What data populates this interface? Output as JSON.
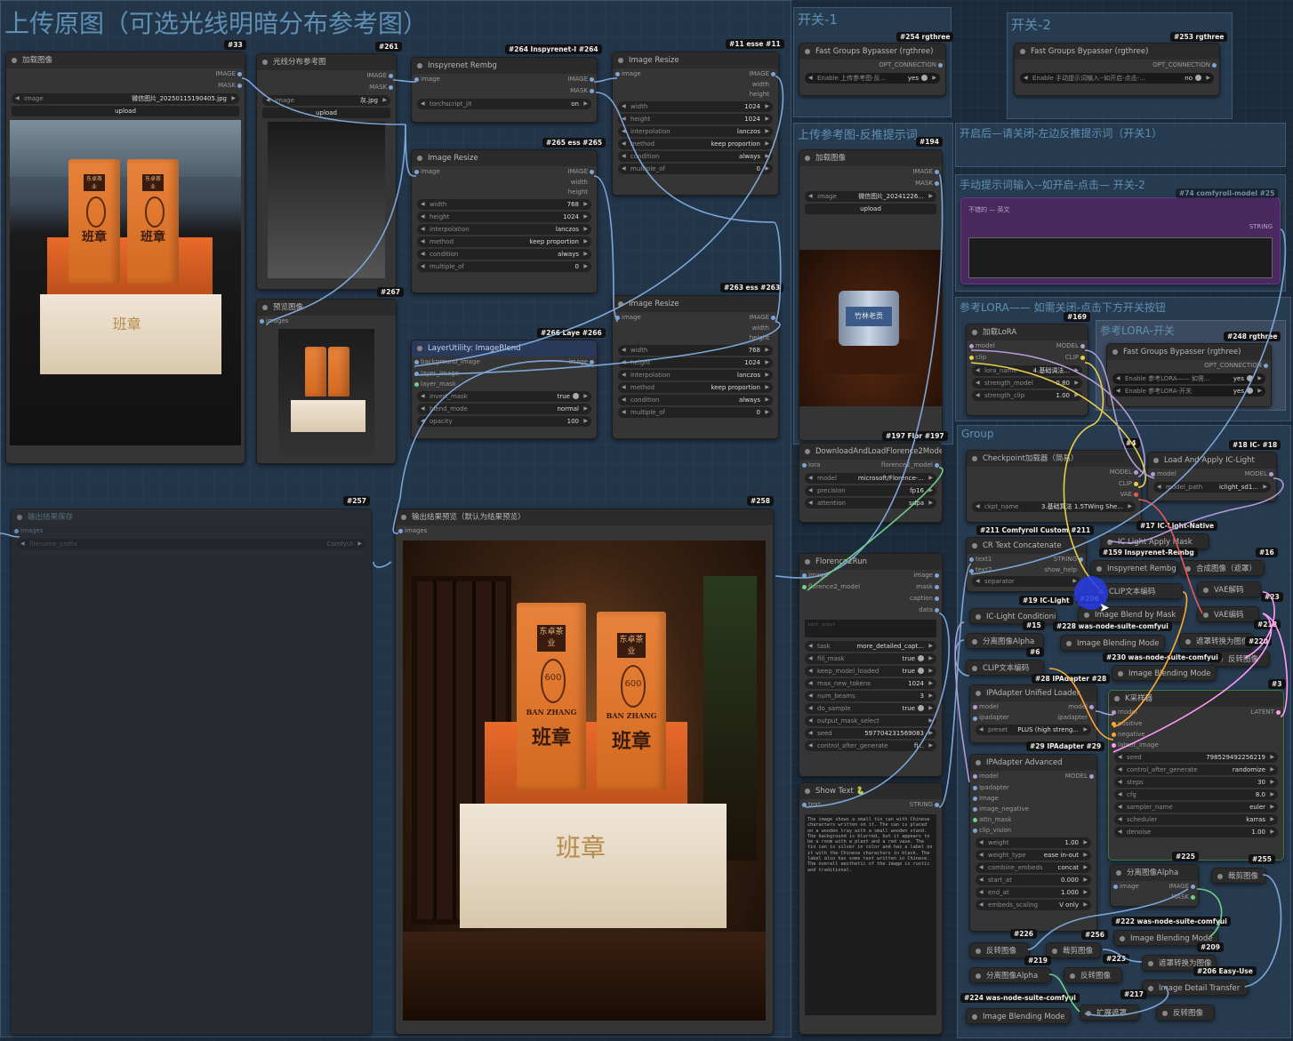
{
  "groups": {
    "main": "上传原图（可选光线明暗分布参考图）",
    "switch1": "开关-1",
    "switch2": "开关-2",
    "ref_upload": "上传参考图-反推提示词",
    "auto_prompt": "开启后—请关闭-左边反推提示词（开关1）",
    "manual_prompt": "手动提示词输入--如开启-点击— 开关-2",
    "lora_group": "参考LORA—— 如需关闭-点击下方开关按钮",
    "lora_switch": "参考LORA-开关",
    "group": "Group"
  },
  "nodes": {
    "load_image": {
      "title": "加载图像",
      "badge": "#33",
      "outputs": [
        "IMAGE",
        "MASK"
      ],
      "image_label": "image",
      "image_value": "微信图片_20250115190405.jpg",
      "upload": "upload"
    },
    "light_ref": {
      "title": "光线分布参考图",
      "badge": "#261",
      "outputs": [
        "IMAGE",
        "MASK"
      ],
      "image_label": "image",
      "image_value": "灰.jpg",
      "upload": "upload"
    },
    "preview": {
      "title": "预览图像",
      "badge": "#267",
      "input": "images"
    },
    "rembg": {
      "title": "Inspyrenet Rembg",
      "badge": "#264 Inspyrenet-I #264",
      "input": "image",
      "outputs": [
        "IMAGE",
        "MASK"
      ],
      "widget_label": "torchscript_jit",
      "widget_value": "on"
    },
    "resize_265": {
      "title": "Image Resize",
      "badge": "#265 ess #265",
      "input": "image",
      "outputs": [
        "IMAGE",
        "width",
        "height"
      ],
      "widgets": [
        {
          "label": "width",
          "value": "768"
        },
        {
          "label": "height",
          "value": "1024"
        },
        {
          "label": "interpolation",
          "value": "lanczos"
        },
        {
          "label": "method",
          "value": "keep proportion"
        },
        {
          "label": "condition",
          "value": "always"
        },
        {
          "label": "multiple_of",
          "value": "0"
        }
      ]
    },
    "resize_11": {
      "title": "Image Resize",
      "badge": "#11 esse #11",
      "input": "image",
      "outputs": [
        "IMAGE",
        "width",
        "height"
      ],
      "widgets": [
        {
          "label": "width",
          "value": "1024"
        },
        {
          "label": "height",
          "value": "1024"
        },
        {
          "label": "interpolation",
          "value": "lanczos"
        },
        {
          "label": "method",
          "value": "keep proportion"
        },
        {
          "label": "condition",
          "value": "always"
        },
        {
          "label": "multiple_of",
          "value": "0"
        }
      ]
    },
    "resize_263": {
      "title": "Image Resize",
      "badge": "#263 ess #263",
      "input": "image",
      "outputs": [
        "IMAGE",
        "width",
        "height"
      ],
      "widgets": [
        {
          "label": "width",
          "value": "768"
        },
        {
          "label": "height",
          "value": "1024"
        },
        {
          "label": "interpolation",
          "value": "lanczos"
        },
        {
          "label": "method",
          "value": "keep proportion"
        },
        {
          "label": "condition",
          "value": "always"
        },
        {
          "label": "multiple_of",
          "value": "0"
        }
      ]
    },
    "blend": {
      "title": "LayerUtility: ImageBlend",
      "badge": "#266 Laye #266",
      "inputs": [
        "background_image",
        "layer_image",
        "layer_mask"
      ],
      "output": "image",
      "widgets": [
        {
          "label": "invert_mask",
          "value": "true"
        },
        {
          "label": "blend_mode",
          "value": "normal"
        },
        {
          "label": "opacity",
          "value": "100"
        }
      ]
    },
    "save": {
      "title": "输出结果保存",
      "badge": "#257",
      "input": "images",
      "prefix_label": "filename_prefix",
      "prefix_value": "ComfyUI"
    },
    "result_preview": {
      "title": "输出结果预览（默认为结果预览）",
      "badge": "#258",
      "input": "images"
    },
    "fast1": {
      "title": "Fast Groups Bypasser (rgthree)",
      "badge": "#254 rgthree",
      "output": "OPT_CONNECTION",
      "toggle_label": "Enable 上传参考图-反...",
      "toggle_value": "yes"
    },
    "fast2": {
      "title": "Fast Groups Bypasser (rgthree)",
      "badge": "#253 rgthree",
      "output": "OPT_CONNECTION",
      "toggle_label": "Enable 手动提示词输入--如开启-点击-...",
      "toggle_value": "no"
    },
    "load_ref": {
      "title": "加载图像",
      "badge": "#194",
      "outputs": [
        "IMAGE",
        "MASK"
      ],
      "image_label": "image",
      "image_value": "微信图片_20241226...",
      "upload": "upload"
    },
    "florence_loader": {
      "title": "DownloadAndLoadFlorence2Model",
      "badge": "#197 Flor #197",
      "input": "lora",
      "output": "florence2_model",
      "widgets": [
        {
          "label": "model",
          "value": "microsoft/Florence-..."
        },
        {
          "label": "precision",
          "value": "fp16"
        },
        {
          "label": "attention",
          "value": "sdpa"
        }
      ]
    },
    "florence_run": {
      "title": "Florence2Run",
      "inputs": [
        "image",
        "florence2_model"
      ],
      "outputs": [
        "image",
        "mask",
        "caption",
        "data"
      ],
      "text_placeholder": "text_input",
      "widgets": [
        {
          "label": "task",
          "value": "more_detailed_capt..."
        },
        {
          "label": "fill_mask",
          "value": "true"
        },
        {
          "label": "keep_model_loaded",
          "value": "true"
        },
        {
          "label": "max_new_tokens",
          "value": "1024"
        },
        {
          "label": "num_beams",
          "value": "3"
        },
        {
          "label": "do_sample",
          "value": "true"
        },
        {
          "label": "output_mask_select",
          "value": ""
        },
        {
          "label": "seed",
          "value": "597704231569083"
        },
        {
          "label": "control_after_generate",
          "value": "fi..."
        }
      ]
    },
    "show_text": {
      "title": "Show Text 🐍",
      "input": "text",
      "output": "STRING",
      "content": "The image shows a small tin can with Chinese characters written on it. The can is placed on a wooden tray with a small wooden stand. The background is blurred, but it appears to be a room with a plant and a red vase. The tin can is silver in color and has a label on it with the Chinese characters in black. The label also has some text written in Chinese. The overall aesthetic of the image is rustic and traditional."
    },
    "manual_text": {
      "badge": "#74 comfyroll-model #25",
      "line1": "不错的 — 英文",
      "hint": "STRING"
    },
    "lora": {
      "title": "加载LoRA",
      "badge": "#169",
      "inputs": [
        "model",
        "clip"
      ],
      "outputs": [
        "MODEL",
        "CLIP"
      ],
      "widgets": [
        {
          "label": "lora_name",
          "value": "4.基础调法..."
        },
        {
          "label": "strength_model",
          "value": "0.80"
        },
        {
          "label": "strength_clip",
          "value": "1.00"
        }
      ]
    },
    "fast_lora": {
      "title": "Fast Groups Bypasser (rgthree)",
      "badge": "#248 rgthree",
      "output": "OPT_CONNECTION",
      "toggles": [
        {
          "label": "Enable 参考LORA—— 如需...",
          "value": "yes"
        },
        {
          "label": "Enable 参考LORA-开关",
          "value": "yes"
        }
      ]
    },
    "checkpoint": {
      "title": "Checkpoint加载器（简易）",
      "badge": "#4",
      "outputs": [
        "MODEL",
        "CLIP",
        "VAE"
      ],
      "widget_label": "ckpt_name",
      "widget_value": "3.基础算法 1.5TWing She..."
    },
    "iclight_load": {
      "title": "Load And Apply IC-Light",
      "badge": "#18 IC- #18",
      "input": "model",
      "output": "MODEL",
      "widget_label": "model_path",
      "widget_value": "iclight_sd1..."
    },
    "labels": {
      "cr_text": "CR Text Concatenate",
      "cr_badge": "#211 Comfyroll Custom #211",
      "text1": "text1",
      "text2": "text2",
      "string": "STRING",
      "show_help": "show_help",
      "separator": "separator",
      "iclight_native": "#17 IC-Light-Native",
      "iclight_mask": "IC Light Apply Mask",
      "rembg159": "#159 Inspyrenet-Rembg",
      "rembg2": "Inspyrenet Rembg",
      "composite": "合成图像（遮罩）",
      "b16": "#16",
      "clip_encode": "CLIP文本编码",
      "vae_decode": "VAE解码",
      "b23": "#23",
      "iclight19": "#19 IC-Light",
      "b206": "#206",
      "iclight_cond": "IC-Light Conditioning",
      "b15": "#15",
      "b228": "#228 was-node-suite-comfyui",
      "blend_mask": "Image Blend by Mask",
      "vae_encode": "VAE编码",
      "b218": "#218",
      "split_alpha": "分离图像Alpha",
      "b6": "#6",
      "blend_mode": "Image Blending Mode",
      "mask_to_img": "遮罩转换为图像",
      "b220": "#220",
      "clip_encode2": "CLIP文本编码",
      "b230": "#230 was-node-suite-comfyui",
      "invert": "反转图像",
      "b28": "#28 IPAdapter #28",
      "blend_mode2": "Image Blending Mode",
      "b3": "#3",
      "ipadapter_loader": "IPAdapter Unified Loader",
      "ksampler": "K采样器",
      "b29": "#29 IPAdapter #29",
      "ipadapter_adv": "IPAdapter Advanced",
      "b225": "#225",
      "b255": "#255",
      "split_alpha2": "分离图像Alpha",
      "crop_img": "裁剪图像",
      "b222": "#222 was-node-suite-comfyui",
      "b226": "#226",
      "b256": "#256",
      "blend_mode3": "Image Blending Mode",
      "b209": "#209",
      "invert2": "反转图像",
      "crop2": "裁剪图像",
      "mask_to_img2": "遮罩转换为图像",
      "b219": "#219",
      "b223": "#223",
      "b206e": "#206 Easy-Use",
      "split_alpha3": "分离图像Alpha",
      "invert3": "反转图像",
      "detail_transfer": "Image Detail Transfer",
      "b217": "#217",
      "b224": "#224 was-node-suite-comfyui",
      "blend_mode4": "Image Blending Mode",
      "expand_mask": "扩展遮罩",
      "invert4": "反转图像"
    },
    "ipadapter_loader_io": {
      "inputs": [
        "model",
        "ipadapter"
      ],
      "outputs": [
        "model",
        "ipadapter"
      ],
      "widget_label": "preset",
      "widget_value": "PLUS (high streng..."
    },
    "ipadapter_adv_io": {
      "inputs": [
        "model",
        "ipadapter",
        "image",
        "image_negative",
        "attn_mask",
        "clip_vision"
      ],
      "output": "MODEL",
      "widgets": [
        {
          "label": "weight",
          "value": "1.00"
        },
        {
          "label": "weight_type",
          "value": "ease in-out"
        },
        {
          "label": "combine_embeds",
          "value": "concat"
        },
        {
          "label": "start_at",
          "value": "0.000"
        },
        {
          "label": "end_at",
          "value": "1.000"
        },
        {
          "label": "embeds_scaling",
          "value": "V only"
        }
      ]
    },
    "ksampler_io": {
      "inputs": [
        "model",
        "positive",
        "negative",
        "latent_image"
      ],
      "output": "LATENT",
      "widgets": [
        {
          "label": "seed",
          "value": "798529492256219"
        },
        {
          "label": "control_after_generate",
          "value": "randomize"
        },
        {
          "label": "steps",
          "value": "30"
        },
        {
          "label": "cfg",
          "value": "8.0"
        },
        {
          "label": "sampler_name",
          "value": "euler"
        },
        {
          "label": "scheduler",
          "value": "karras"
        },
        {
          "label": "denoise",
          "value": "1.00"
        }
      ]
    },
    "split_alpha_io": {
      "input": "image",
      "outputs": [
        "IMAGE",
        "MASK"
      ]
    }
  },
  "product": {
    "brand_seal": "东卓茶业",
    "medal": "600",
    "name_cn": "班章",
    "name_en": "BAN ZHANG",
    "tin_label": "竹林老贡"
  }
}
